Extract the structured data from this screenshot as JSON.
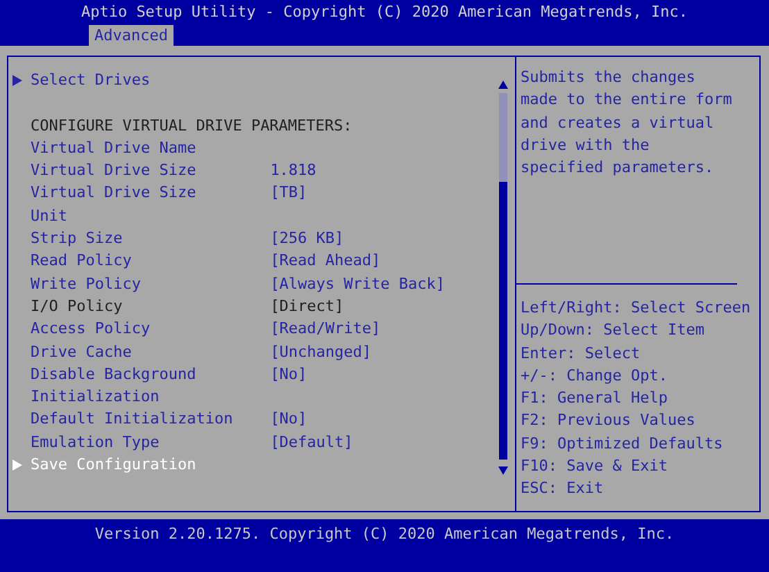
{
  "window": {
    "title": "Aptio Setup Utility - Copyright (C) 2020 American Megatrends, Inc."
  },
  "tabs": [
    {
      "label": "Advanced",
      "selected": true
    }
  ],
  "items": [
    {
      "kind": "submenu",
      "label": "Select Drives",
      "selected": false
    },
    {
      "kind": "heading",
      "label": "CONFIGURE VIRTUAL DRIVE PARAMETERS:",
      "selected": false
    },
    {
      "kind": "option",
      "label": "Virtual Drive Name",
      "selected": false
    },
    {
      "kind": "option",
      "label": "Virtual Drive Size",
      "value": "1.818",
      "selected": false
    },
    {
      "kind": "option",
      "label": "Virtual Drive Size Unit",
      "value": "[TB]",
      "selected": false
    },
    {
      "kind": "option",
      "label": "Strip Size",
      "value": "[256 KB]",
      "selected": false
    },
    {
      "kind": "option",
      "label": "Read Policy",
      "value": "[Read Ahead]",
      "selected": false
    },
    {
      "kind": "option",
      "label": "Write Policy",
      "value": "[Always Write Back]",
      "selected": false
    },
    {
      "kind": "static",
      "label": "I/O Policy",
      "value": "[Direct]",
      "selected": false
    },
    {
      "kind": "option",
      "label": "Access Policy",
      "value": "[Read/Write]",
      "selected": false
    },
    {
      "kind": "option",
      "label": "Drive Cache",
      "value": "[Unchanged]",
      "selected": false
    },
    {
      "kind": "option",
      "label": "Disable Background Initialization",
      "value": "[No]",
      "selected": false
    },
    {
      "kind": "option",
      "label": "Default Initialization",
      "value": "[No]",
      "selected": false
    },
    {
      "kind": "option",
      "label": "Emulation Type",
      "value": "[Default]",
      "selected": false
    },
    {
      "kind": "submenu",
      "label": "Save Configuration",
      "selected": true
    }
  ],
  "help": {
    "description": "Submits the changes made to the entire form and creates a virtual drive with the specified parameters.",
    "keys": [
      "Left/Right: Select Screen",
      "Up/Down: Select Item",
      "Enter: Select",
      "+/-: Change Opt.",
      "F1: General Help",
      "F2: Previous Values",
      "F9: Optimized Defaults",
      "F10: Save & Exit",
      "ESC: Exit"
    ]
  },
  "status_bar": "Version 2.20.1275. Copyright (C) 2020 American Megatrends, Inc."
}
